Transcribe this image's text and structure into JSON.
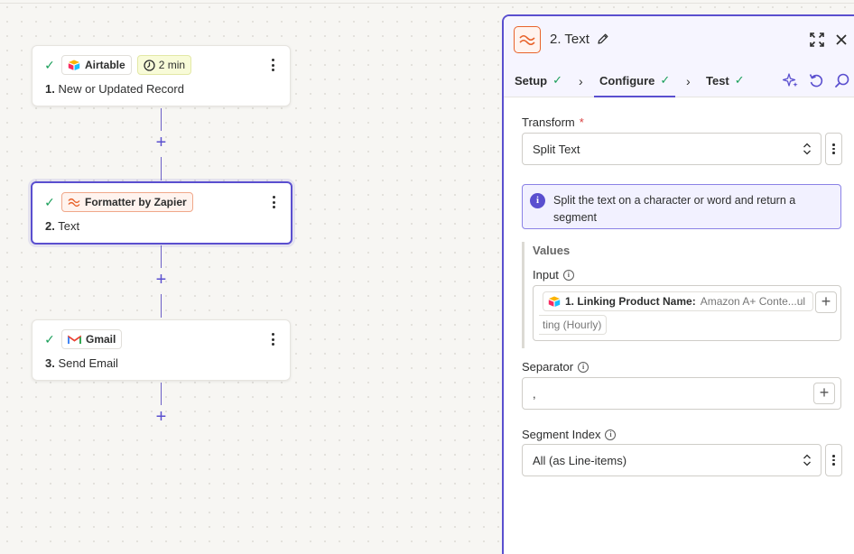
{
  "canvas": {
    "steps": [
      {
        "app": "Airtable",
        "duration": "2 min",
        "number": "1.",
        "title": "New or Updated Record"
      },
      {
        "app": "Formatter by Zapier",
        "number": "2.",
        "title": "Text"
      },
      {
        "app": "Gmail",
        "number": "3.",
        "title": "Send Email"
      }
    ],
    "add_symbol": "+"
  },
  "panel": {
    "title": "2. Text",
    "tabs": [
      {
        "label": "Setup",
        "checked": true
      },
      {
        "label": "Configure",
        "checked": true,
        "active": true
      },
      {
        "label": "Test",
        "checked": true
      }
    ],
    "check_mark": "✓",
    "chevron": "›",
    "transform": {
      "label": "Transform",
      "required_mark": "*",
      "value": "Split Text"
    },
    "info": "Split the text on a character or word and return a segment",
    "values": {
      "title": "Values",
      "input": {
        "label": "Input",
        "pill_label": "1. Linking Product Name:",
        "pill_value": "Amazon A+ Conte...ul",
        "overflow_text": "ting (Hourly)"
      }
    },
    "separator": {
      "label": "Separator",
      "value": ","
    },
    "segment_index": {
      "label": "Segment Index",
      "value": "All (as Line-items)"
    }
  },
  "colors": {
    "accent": "#5a4fcf",
    "success": "#1a9f5a",
    "formatter": "#e8632b",
    "required": "#d93f3f"
  },
  "icons": [
    "check-icon",
    "airtable-icon",
    "clock-icon",
    "formatter-icon",
    "gmail-icon",
    "kebab-icon",
    "pencil-icon",
    "expand-icon",
    "close-icon",
    "sparkle-icon",
    "undo-icon",
    "search-icon",
    "info-icon",
    "updown-icon",
    "plus-icon"
  ]
}
